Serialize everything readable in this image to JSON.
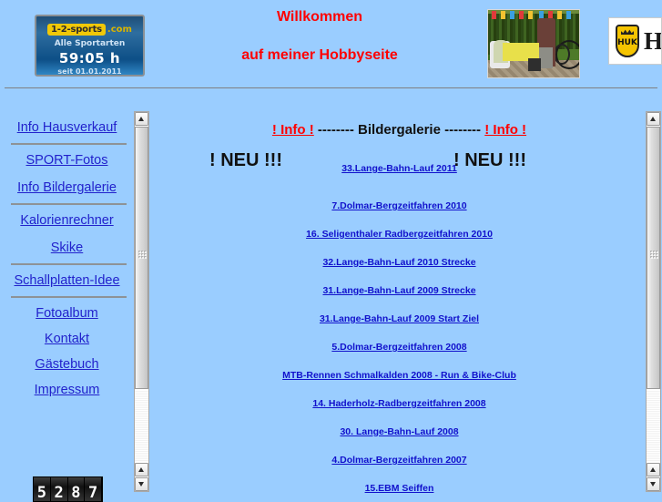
{
  "header": {
    "welcome_line1": "Willkommen",
    "welcome_line2": "auf meiner Hobbyseite",
    "welcome_color": "#FF0000",
    "badge": {
      "brand": "1-2-sports",
      "domain": ".com",
      "subtitle": "Alle Sportarten",
      "time": "59:05 h",
      "since": "seit 01.01.2011"
    },
    "photo_alt": "garden-party-photo",
    "huk": {
      "shield_text": "HUK",
      "wordmark": "H"
    }
  },
  "sidebar": {
    "items": [
      {
        "label": "Info Hausverkauf"
      },
      {
        "label": "SPORT-Fotos "
      },
      {
        "label": "Info Bildergalerie"
      },
      {
        "label": "Kalorienrechner"
      },
      {
        "label": "Skike"
      },
      {
        "label": "Schallplatten-Idee"
      },
      {
        "label": "Fotoalbum"
      },
      {
        "label": "Kontakt"
      },
      {
        "label": "Gästebuch"
      },
      {
        "label": "Impressum"
      }
    ],
    "counter_digits": [
      "5",
      "2",
      "8",
      "7"
    ]
  },
  "main": {
    "info_left": "! Info !",
    "info_middle": "-------- Bildergalerie --------",
    "info_right": "! Info !",
    "neu_left": "! NEU !!!",
    "neu_right": "! NEU !!!",
    "gallery_links": [
      {
        "label": "33.Lange-Bahn-Lauf 2011"
      },
      {
        "label": "7.Dolmar-Bergzeitfahren 2010"
      },
      {
        "label": "16. Seligenthaler Radbergzeitfahren 2010"
      },
      {
        "label": "32.Lange-Bahn-Lauf 2010 Strecke"
      },
      {
        "label": "31.Lange-Bahn-Lauf 2009 Strecke"
      },
      {
        "label": "31.Lange-Bahn-Lauf 2009 Start Ziel"
      },
      {
        "label": "5.Dolmar-Bergzeitfahren 2008"
      },
      {
        "label": "MTB-Rennen Schmalkalden 2008 - Run & Bike-Club"
      },
      {
        "label": "14. Haderholz-Radbergzeitfahren 2008"
      },
      {
        "label": "30. Lange-Bahn-Lauf 2008"
      },
      {
        "label": "4.Dolmar-Bergzeitfahren 2007"
      },
      {
        "label": "15.EBM Seiffen"
      }
    ]
  },
  "colors": {
    "page_background": "#9ACDFF",
    "link": "#2222CC",
    "accent_red": "#FF0000"
  }
}
